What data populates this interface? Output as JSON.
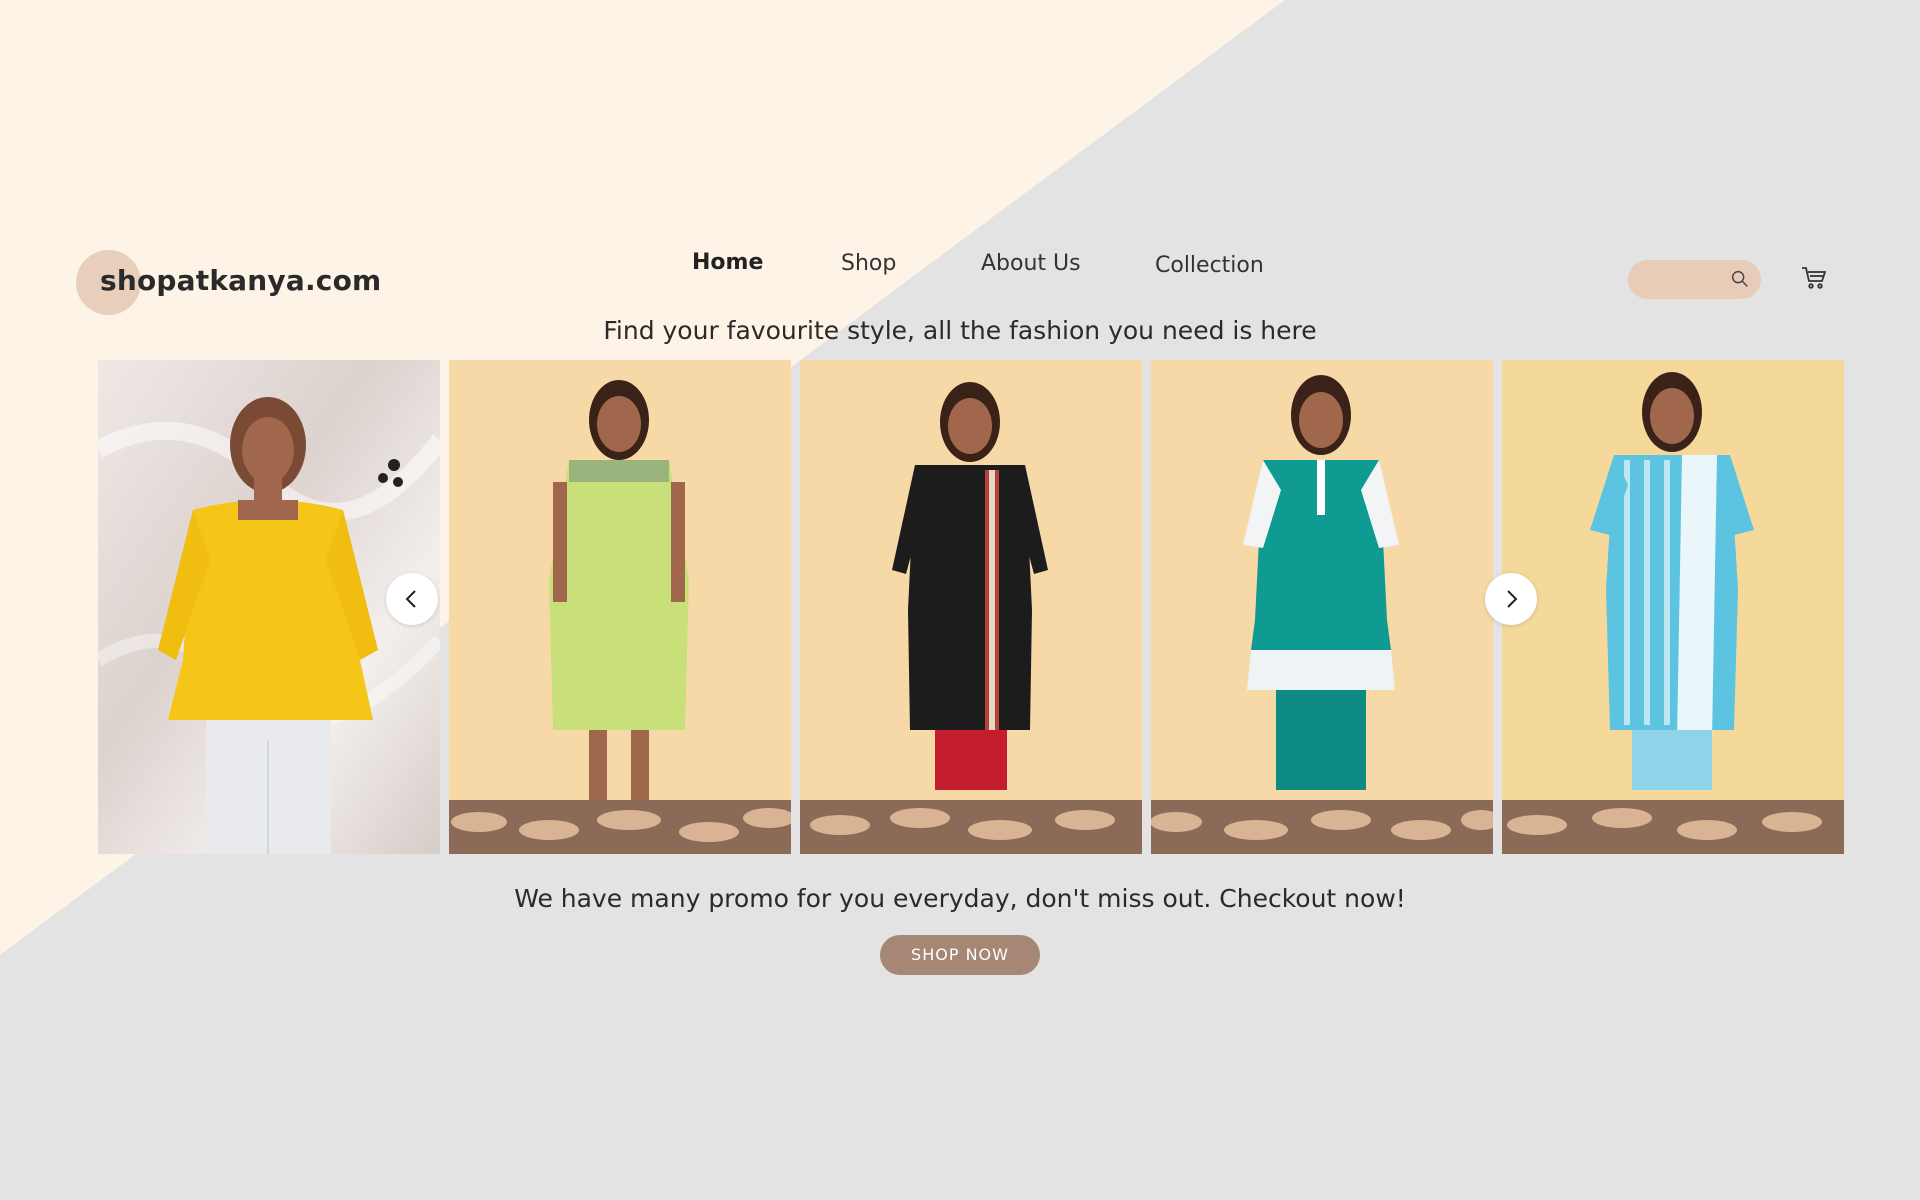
{
  "brand": {
    "name": "shopatkanya.com"
  },
  "nav": {
    "items": [
      "Home",
      "Shop",
      "About Us",
      "Collection"
    ],
    "active": "Home"
  },
  "search": {
    "placeholder": ""
  },
  "tagline": "Find your favourite style, all the fashion you need is here",
  "gallery": {
    "items": [
      {
        "outfit": "yellow-peplum-top",
        "background": "satin"
      },
      {
        "outfit": "green-sleeveless-kurta",
        "background": "peach-wall"
      },
      {
        "outfit": "black-printed-kurta",
        "background": "peach-wall"
      },
      {
        "outfit": "teal-kurta-set",
        "background": "peach-wall"
      },
      {
        "outfit": "blue-striped-kurta-dupatta",
        "background": "peach-wall"
      }
    ],
    "prev_icon": "chevron-left-icon",
    "next_icon": "chevron-right-icon"
  },
  "promo": {
    "text": "We have many promo for you everyday, don't miss out. Checkout now!",
    "button": "SHOP NOW"
  },
  "colors": {
    "cream": "#fdf3e6",
    "grey": "#e3e3e3",
    "accent": "#a68675",
    "search_bg": "#e9ccb7"
  }
}
